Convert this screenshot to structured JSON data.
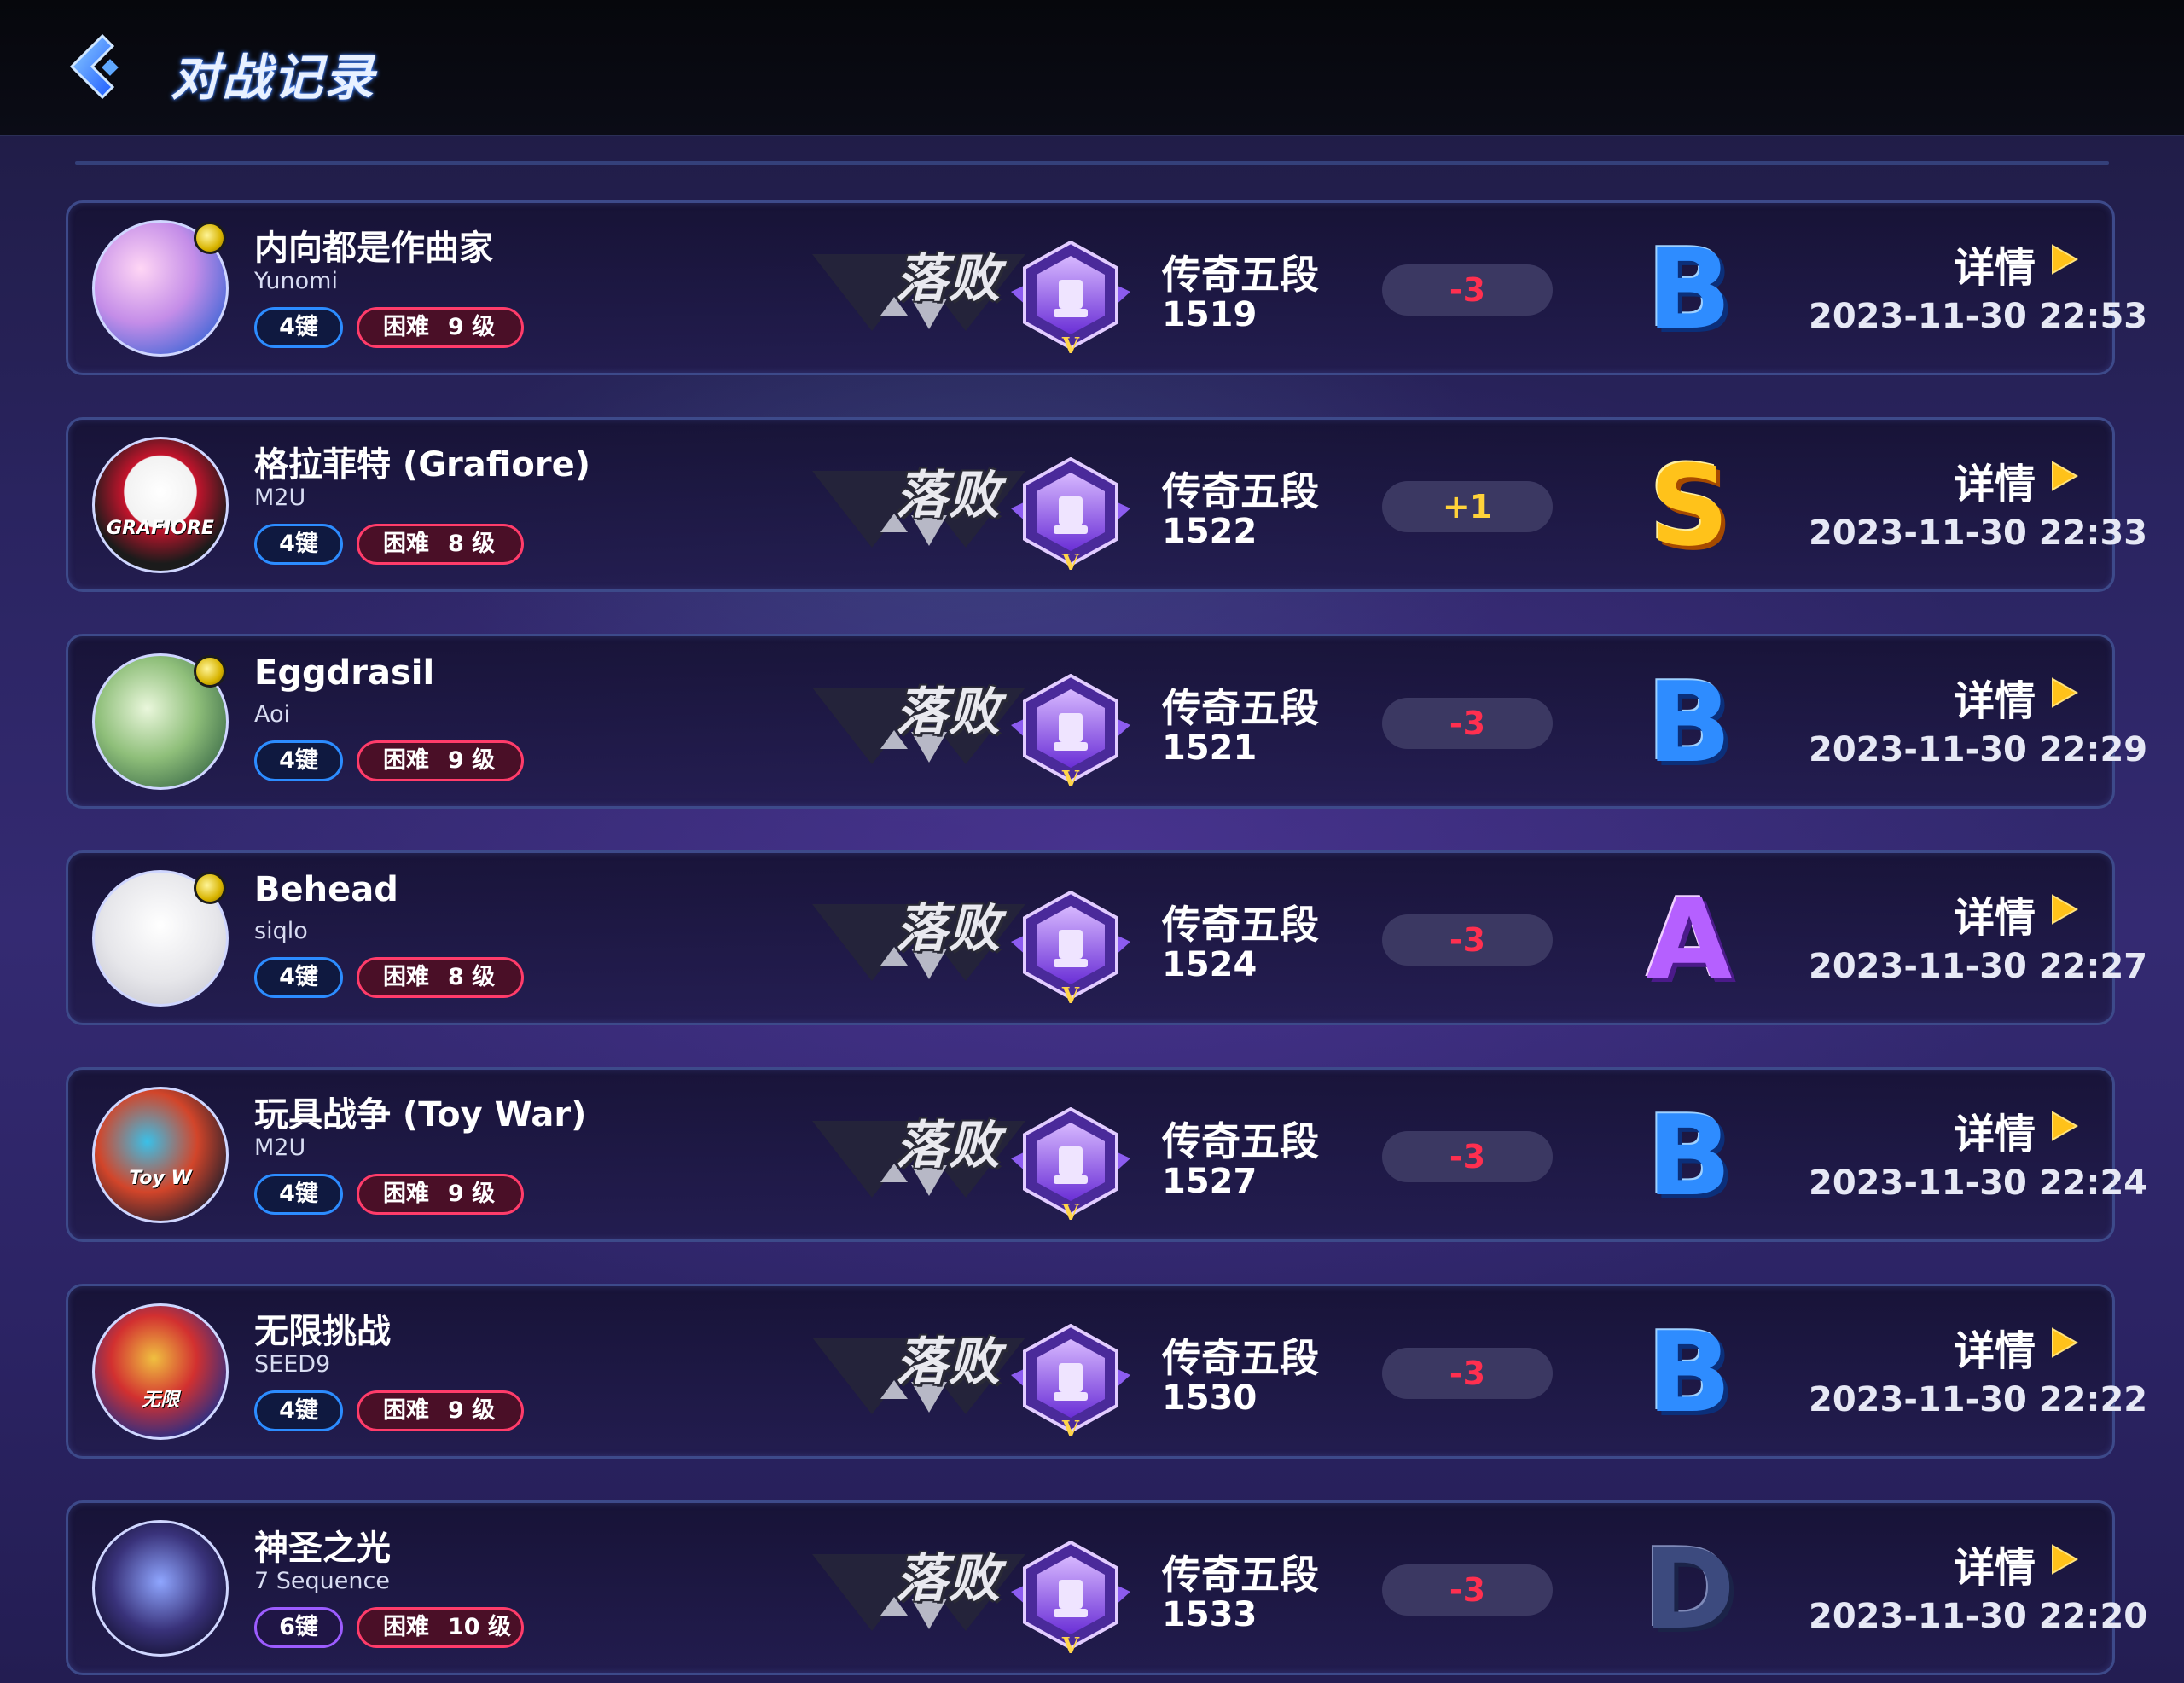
{
  "header": {
    "title": "对战记录",
    "back_icon": "back-arrow-icon"
  },
  "colors": {
    "key_pill_blue": "#2c8cff",
    "key_pill_purple": "#9c5cff",
    "difficulty_pill": "#ff3c6a",
    "delta_negative": "#ff2f4f",
    "delta_positive": "#ffd23a",
    "grade_B": "#2e8cff",
    "grade_S": "#ffc21a",
    "grade_A": "#b560ff",
    "grade_D": "#3c4a7e"
  },
  "records": [
    {
      "title": "内向都是作曲家",
      "artist": "Yunomi",
      "keys": "4键",
      "difficulty": "困难",
      "level": "9 级",
      "result": "落败",
      "rank": "传奇五段",
      "rating": "1519",
      "delta": "-3",
      "grade": "B",
      "detail": "详情",
      "date": "2023-11-30 22:53",
      "has_badge": true
    },
    {
      "title": "格拉菲特 (Grafiore)",
      "artist": "M2U",
      "keys": "4键",
      "difficulty": "困难",
      "level": "8 级",
      "result": "落败",
      "rank": "传奇五段",
      "rating": "1522",
      "delta": "+1",
      "grade": "S",
      "detail": "详情",
      "date": "2023-11-30 22:33",
      "has_badge": false,
      "avatar_text": "GRAFIORE"
    },
    {
      "title": "Eggdrasil",
      "artist": "Aoi",
      "keys": "4键",
      "difficulty": "困难",
      "level": "9 级",
      "result": "落败",
      "rank": "传奇五段",
      "rating": "1521",
      "delta": "-3",
      "grade": "B",
      "detail": "详情",
      "date": "2023-11-30 22:29",
      "has_badge": true
    },
    {
      "title": "Behead",
      "artist": "siqlo",
      "keys": "4键",
      "difficulty": "困难",
      "level": "8 级",
      "result": "落败",
      "rank": "传奇五段",
      "rating": "1524",
      "delta": "-3",
      "grade": "A",
      "detail": "详情",
      "date": "2023-11-30 22:27",
      "has_badge": true
    },
    {
      "title": "玩具战争 (Toy War)",
      "artist": "M2U",
      "keys": "4键",
      "difficulty": "困难",
      "level": "9 级",
      "result": "落败",
      "rank": "传奇五段",
      "rating": "1527",
      "delta": "-3",
      "grade": "B",
      "detail": "详情",
      "date": "2023-11-30 22:24",
      "has_badge": false,
      "avatar_text": "Toy W"
    },
    {
      "title": "无限挑战",
      "artist": "SEED9",
      "keys": "4键",
      "difficulty": "困难",
      "level": "9 级",
      "result": "落败",
      "rank": "传奇五段",
      "rating": "1530",
      "delta": "-3",
      "grade": "B",
      "detail": "详情",
      "date": "2023-11-30 22:22",
      "has_badge": false,
      "avatar_text": "无限"
    },
    {
      "title": "神圣之光",
      "artist": "7 Sequence",
      "keys": "6键",
      "difficulty": "困难",
      "level": "10 级",
      "result": "落败",
      "rank": "传奇五段",
      "rating": "1533",
      "delta": "-3",
      "grade": "D",
      "detail": "详情",
      "date": "2023-11-30 22:20",
      "has_badge": false
    }
  ]
}
